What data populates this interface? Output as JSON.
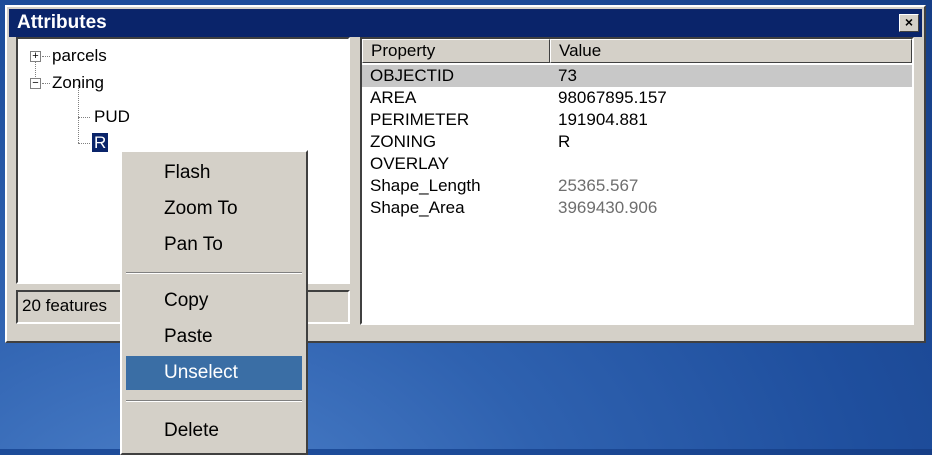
{
  "window": {
    "title": "Attributes",
    "close_glyph": "×"
  },
  "tree": {
    "nodes": [
      {
        "label": "parcels",
        "expander": "+"
      },
      {
        "label": "Zoning",
        "expander": "−"
      },
      {
        "label": "PUD"
      },
      {
        "label": "R"
      }
    ]
  },
  "status": {
    "text": "20 features"
  },
  "properties": {
    "headers": {
      "property": "Property",
      "value": "Value"
    },
    "rows": [
      {
        "property": "OBJECTID",
        "value": "73"
      },
      {
        "property": "AREA",
        "value": "98067895.157"
      },
      {
        "property": "PERIMETER",
        "value": "191904.881"
      },
      {
        "property": "ZONING",
        "value": "R"
      },
      {
        "property": "OVERLAY",
        "value": ""
      },
      {
        "property": "Shape_Length",
        "value": "25365.567"
      },
      {
        "property": "Shape_Area",
        "value": "3969430.906"
      }
    ]
  },
  "context_menu": {
    "items": [
      {
        "label": "Flash"
      },
      {
        "label": "Zoom To"
      },
      {
        "label": "Pan To"
      },
      {
        "label": "Copy"
      },
      {
        "label": "Paste"
      },
      {
        "label": "Unselect"
      },
      {
        "label": "Delete"
      }
    ]
  },
  "colors": {
    "titlebar": "#0a246a",
    "menu_highlight": "#3a6ea5",
    "row_highlight": "#c8c8c8"
  }
}
